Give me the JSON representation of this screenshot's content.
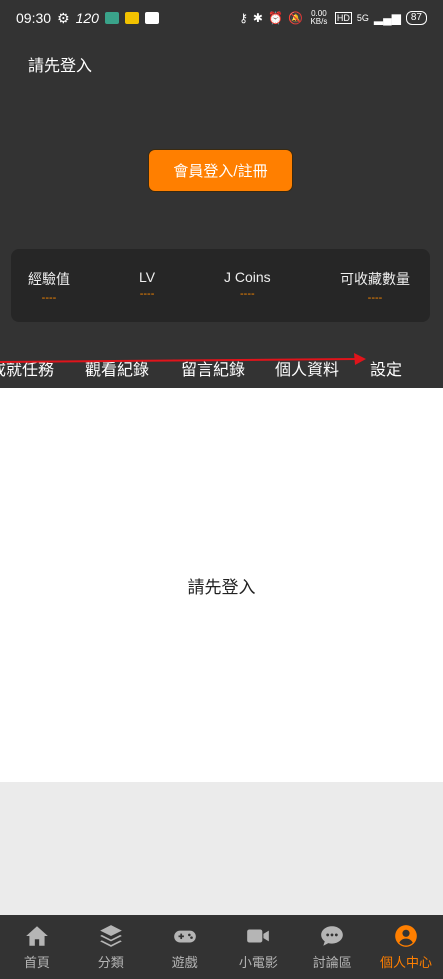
{
  "status_bar": {
    "time": "09:30",
    "network_speed": "120",
    "data_rate": "0.00 KB/s",
    "network_type": "5G",
    "battery": "87"
  },
  "header": {
    "login_prompt": "請先登入",
    "login_button": "會員登入/註冊"
  },
  "stats": [
    {
      "label": "經驗值",
      "value": "----"
    },
    {
      "label": "LV",
      "value": "----"
    },
    {
      "label": "J Coins",
      "value": "----"
    },
    {
      "label": "可收藏數量",
      "value": "----"
    }
  ],
  "tabs": [
    "成就任務",
    "觀看紀錄",
    "留言紀錄",
    "個人資料",
    "設定"
  ],
  "content": {
    "message": "請先登入"
  },
  "bottom_nav": [
    {
      "label": "首頁",
      "icon": "home-icon"
    },
    {
      "label": "分類",
      "icon": "layers-icon"
    },
    {
      "label": "遊戲",
      "icon": "gamepad-icon"
    },
    {
      "label": "小電影",
      "icon": "video-camera-icon"
    },
    {
      "label": "討論區",
      "icon": "chat-bubble-icon"
    },
    {
      "label": "個人中心",
      "icon": "user-circle-icon",
      "active": true
    }
  ],
  "colors": {
    "accent": "#ff7f00",
    "header_bg": "#333333",
    "card_bg": "#262626",
    "swipe_arrow": "#e0141b"
  }
}
